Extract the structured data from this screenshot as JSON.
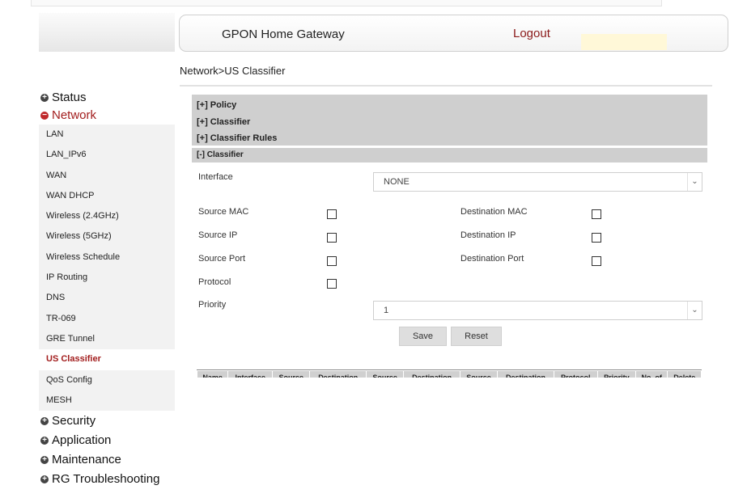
{
  "header": {
    "title": "GPON Home Gateway",
    "logout_label": "Logout"
  },
  "breadcrumb": "Network>US Classifier",
  "sidebar": {
    "status": "Status",
    "network": "Network",
    "network_items": [
      "LAN",
      "LAN_IPv6",
      "WAN",
      "WAN DHCP",
      "Wireless (2.4GHz)",
      "Wireless (5GHz)",
      "Wireless Schedule",
      "IP Routing",
      "DNS",
      "TR-069",
      "GRE Tunnel",
      "US Classifier",
      "QoS Config",
      "MESH"
    ],
    "security": "Security",
    "application": "Application",
    "maintenance": "Maintenance",
    "rg_troubleshooting": "RG Troubleshooting"
  },
  "sections": {
    "policy": "[+] Policy",
    "classifier": "[+] Classifier",
    "classifier_rules": "[+] Classifier Rules",
    "classifier_open": "[-] Classifier"
  },
  "form": {
    "interface_label": "Interface",
    "interface_value": "NONE",
    "source_mac": "Source MAC",
    "destination_mac": "Destination MAC",
    "source_ip": "Source IP",
    "destination_ip": "Destination IP",
    "source_port": "Source Port",
    "destination_port": "Destination Port",
    "protocol": "Protocol",
    "priority_label": "Priority",
    "priority_value": "1",
    "save_label": "Save",
    "reset_label": "Reset"
  },
  "table": {
    "headers": [
      "Name",
      "Interface",
      "Source",
      "Destination",
      "Source",
      "Destination",
      "Source",
      "Destination",
      "Protocol",
      "Priority",
      "No. of",
      "Delete"
    ]
  }
}
